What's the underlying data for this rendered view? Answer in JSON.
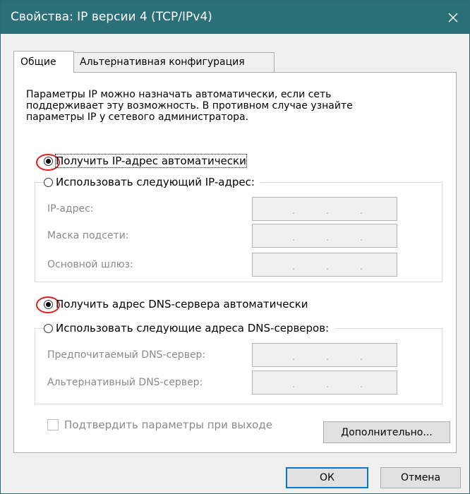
{
  "window": {
    "title": "Свойства: IP версии 4 (TCP/IPv4)",
    "close_symbol": "✕"
  },
  "tabs": [
    {
      "label": "Общие",
      "active": true
    },
    {
      "label": "Альтернативная конфигурация",
      "active": false
    }
  ],
  "description": [
    "Параметры IP можно назначать автоматически, если сеть",
    "поддерживает эту возможность. В противном случае узнайте",
    "параметры IP у сетевого администратора."
  ],
  "ip": {
    "auto_label": "Получить IP-адрес автоматически",
    "manual_label": "Использовать следующий IP-адрес:",
    "selected": "auto",
    "fields": [
      {
        "label": "IP-адрес:"
      },
      {
        "label": "Маска подсети:"
      },
      {
        "label": "Основной шлюз:"
      }
    ]
  },
  "dns": {
    "auto_label": "Получить адрес DNS-сервера автоматически",
    "manual_label": "Использовать следующие адреса DNS-серверов:",
    "selected": "auto",
    "fields": [
      {
        "label": "Предпочитаемый DNS-сервер:"
      },
      {
        "label": "Альтернативный DNS-сервер:"
      }
    ]
  },
  "validate_label": "Подтвердить параметры при выходе",
  "buttons": {
    "advanced": "Дополнительно...",
    "ok": "ОК",
    "cancel": "Отмена"
  },
  "ip_dot": ".",
  "colors": {
    "titlebar": "#2b6f78",
    "highlight": "#e01e1e",
    "focus_border": "#0078d7"
  }
}
